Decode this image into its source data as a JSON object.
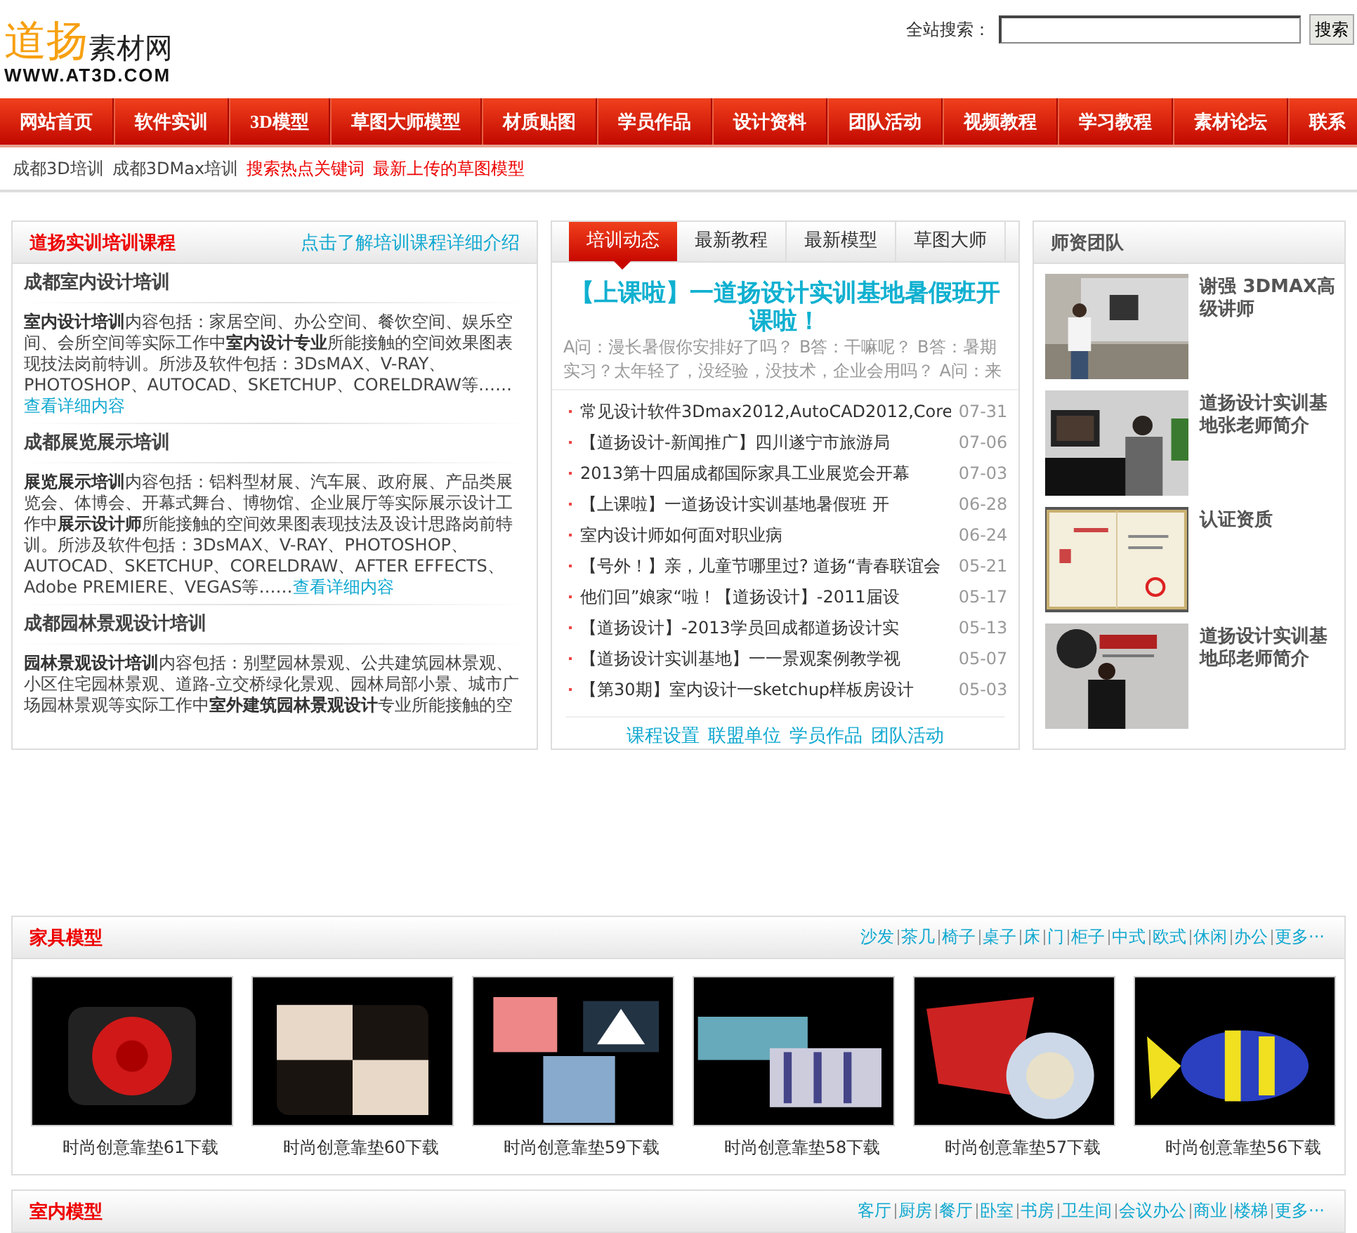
{
  "site": {
    "logo_main": "道扬",
    "logo_sub": "素材网",
    "logo_url": "WWW.AT3D.COM"
  },
  "search": {
    "label": "全站搜索：",
    "button": "搜索"
  },
  "nav": [
    "网站首页",
    "软件实训",
    "3D模型",
    "草图大师模型",
    "材质贴图",
    "学员作品",
    "设计资料",
    "团队活动",
    "视频教程",
    "学习教程",
    "素材论坛",
    "联系"
  ],
  "subnav": [
    {
      "label": "成都3D培训",
      "kind": "plain"
    },
    {
      "label": "成都3DMax培训",
      "kind": "plain"
    },
    {
      "label": "搜索热点关键词",
      "kind": "hot"
    },
    {
      "label": "最新上传的草图模型",
      "kind": "hot"
    }
  ],
  "training": {
    "title": "道扬实训培训课程",
    "more": "点击了解培训课程详细介绍",
    "sections": [
      {
        "heading": "成都室内设计培训",
        "body": "**室内设计培训**内容包括：家居空间、办公空间、餐饮空间、娱乐空间、会所空间等实际工作中**室内设计专业**所能接触的空间效果图表现技法岗前特训。所涉及软件包括：3DsMAX、V-RAY、PHOTOSHOP、AUTOCAD、SKETCHUP、CORELDRAW等……",
        "link": "查看详细内容"
      },
      {
        "heading": "成都展览展示培训",
        "body": "**展览展示培训**内容包括：铝料型材展、汽车展、政府展、产品类展览会、体博会、开幕式舞台、博物馆、企业展厅等实际展示设计工作中**展示设计师**所能接触的空间效果图表现技法及设计思路岗前特训。所涉及软件包括：3DsMAX、V-RAY、PHOTOSHOP、AUTOCAD、SKETCHUP、CORELDRAW、AFTER EFFECTS、Adobe PREMIERE、VEGAS等……",
        "link": "查看详细内容"
      },
      {
        "heading": "成都园林景观设计培训",
        "body": "**园林景观设计培训**内容包括：别墅园林景观、公共建筑园林景观、小区住宅园林景观、道路-立交桥绿化景观、园林局部小景、城市广场园林景观等实际工作中**室外建筑园林景观设计**专业所能接触的空"
      }
    ]
  },
  "news": {
    "tabs": [
      {
        "label": "培训动态",
        "selected": true
      },
      {
        "label": "最新教程",
        "selected": false
      },
      {
        "label": "最新模型",
        "selected": false
      },
      {
        "label": "草图大师",
        "selected": false
      }
    ],
    "headline": "【上课啦】一道扬设计实训基地暑假班开课啦！",
    "summary": "A问：漫长暑假你安排好了吗？ B答：干嘛呢？ B答：暑期实习？太年轻了，没经验，没技术，企业会用吗？ A问：来",
    "items": [
      {
        "title": "常见设计软件3Dmax2012,AutoCAD2012,Core",
        "date": "07-31"
      },
      {
        "title": "【道扬设计-新闻推广】四川遂宁市旅游局",
        "date": "07-06"
      },
      {
        "title": "2013第十四届成都国际家具工业展览会开幕",
        "date": "07-03"
      },
      {
        "title": "【上课啦】一道扬设计实训基地暑假班 开",
        "date": "06-28"
      },
      {
        "title": "室内设计师如何面对职业病",
        "date": "06-24"
      },
      {
        "title": "【号外！】亲，儿童节哪里过? 道扬“青春联谊会",
        "date": "05-21"
      },
      {
        "title": "他们回”娘家“啦！【道扬设计】-2011届设",
        "date": "05-17"
      },
      {
        "title": "【道扬设计】-2013学员回成都道扬设计实",
        "date": "05-13"
      },
      {
        "title": "【道扬设计实训基地】一一景观案例教学视",
        "date": "05-07"
      },
      {
        "title": "【第30期】室内设计一sketchup样板房设计",
        "date": "05-03"
      }
    ],
    "footer_links": [
      "课程设置",
      "联盟单位",
      "学员作品",
      "团队活动"
    ]
  },
  "team": {
    "title": "师资团队",
    "members": [
      "谢强 3DMAX高级讲师",
      "道扬设计实训基地张老师简介",
      "认证资质",
      "道扬设计实训基地邱老师简介"
    ]
  },
  "model_sections": [
    {
      "title": "家具模型",
      "tags": [
        "沙发",
        "茶几",
        "椅子",
        "桌子",
        "床",
        "门",
        "柜子",
        "中式",
        "欧式",
        "休闲",
        "办公",
        "更多···"
      ],
      "items": [
        "时尚创意靠垫61下载",
        "时尚创意靠垫60下载",
        "时尚创意靠垫59下载",
        "时尚创意靠垫58下载",
        "时尚创意靠垫57下载",
        "时尚创意靠垫56下载"
      ]
    },
    {
      "title": "室内模型",
      "tags": [
        "客厅",
        "厨房",
        "餐厅",
        "卧室",
        "书房",
        "卫生间",
        "会议办公",
        "商业",
        "楼梯",
        "更多···"
      ]
    }
  ]
}
